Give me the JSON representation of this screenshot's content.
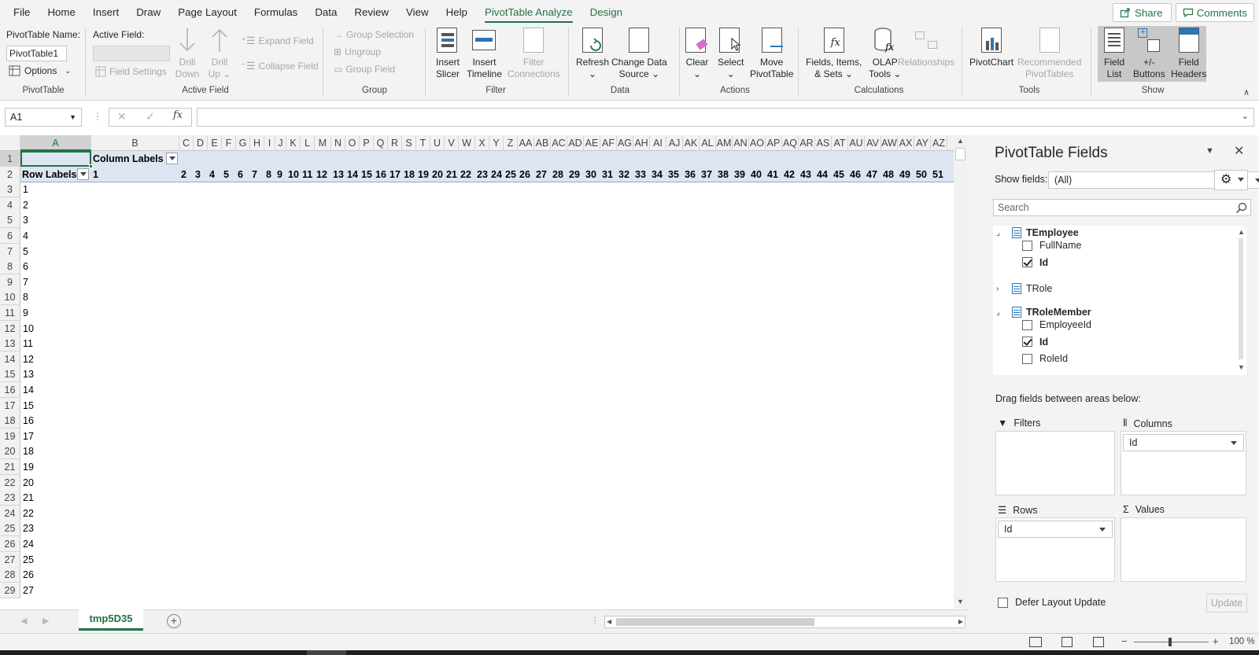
{
  "ribbon_tabs": [
    "File",
    "Home",
    "Insert",
    "Draw",
    "Page Layout",
    "Formulas",
    "Data",
    "Review",
    "View",
    "Help",
    "PivotTable Analyze",
    "Design"
  ],
  "active_tab": "PivotTable Analyze",
  "share_label": "Share",
  "comments_label": "Comments",
  "pivottable_group": {
    "name_label": "PivotTable Name:",
    "name_value": "PivotTable1",
    "options_label": "Options",
    "group_label": "PivotTable"
  },
  "active_field_group": {
    "label": "Active Field:",
    "field_settings": "Field Settings",
    "drill_down": [
      "Drill",
      "Down"
    ],
    "drill_up": [
      "Drill",
      "Up"
    ],
    "expand_field": "Expand Field",
    "collapse_field": "Collapse Field",
    "group_label": "Active Field"
  },
  "group_group": {
    "group_selection": "Group Selection",
    "ungroup": "Ungroup",
    "group_field": "Group Field",
    "group_label": "Group"
  },
  "filter_group": {
    "insert_slicer": [
      "Insert",
      "Slicer"
    ],
    "insert_timeline": [
      "Insert",
      "Timeline"
    ],
    "filter_connections": [
      "Filter",
      "Connections"
    ],
    "group_label": "Filter"
  },
  "data_group": {
    "refresh": "Refresh",
    "change_data_source": [
      "Change Data",
      "Source"
    ],
    "group_label": "Data"
  },
  "actions_group": {
    "clear": "Clear",
    "select": "Select",
    "move_pivottable": [
      "Move",
      "PivotTable"
    ],
    "group_label": "Actions"
  },
  "calculations_group": {
    "fields_items_sets": [
      "Fields, Items,",
      "& Sets"
    ],
    "olap_tools": [
      "OLAP",
      "Tools"
    ],
    "relationships": "Relationships",
    "group_label": "Calculations"
  },
  "tools_group": {
    "pivotchart": "PivotChart",
    "recommended_pivottables": [
      "Recommended",
      "PivotTables"
    ],
    "group_label": "Tools"
  },
  "show_group": {
    "field_list": [
      "Field",
      "List"
    ],
    "buttons": [
      "+/-",
      "Buttons"
    ],
    "field_headers": [
      "Field",
      "Headers"
    ],
    "group_label": "Show"
  },
  "name_box": "A1",
  "fx_label": "fx",
  "columns": [
    "A",
    "B",
    "C",
    "D",
    "E",
    "F",
    "G",
    "H",
    "I",
    "J",
    "K",
    "L",
    "M",
    "N",
    "O",
    "P",
    "Q",
    "R",
    "S",
    "T",
    "U",
    "V",
    "W",
    "X",
    "Y",
    "Z",
    "AA",
    "AB",
    "AC",
    "AD",
    "AE",
    "AF",
    "AG",
    "AH",
    "AI",
    "AJ",
    "AK",
    "AL",
    "AM",
    "AN",
    "AO",
    "AP",
    "AQ",
    "AR",
    "AS",
    "AT",
    "AU",
    "AV",
    "AW",
    "AX",
    "AY",
    "AZ"
  ],
  "rows": [
    "1",
    "2",
    "3",
    "4",
    "5",
    "6",
    "7",
    "8",
    "9",
    "10",
    "11",
    "12",
    "13",
    "14",
    "15",
    "16",
    "17",
    "18",
    "19",
    "20",
    "21",
    "22",
    "23",
    "24",
    "25",
    "26",
    "27",
    "28",
    "29"
  ],
  "pivot": {
    "column_labels": "Column Labels",
    "row_labels": "Row Labels",
    "column_values": [
      "1",
      "2",
      "3",
      "4",
      "5",
      "6",
      "7",
      "8",
      "9",
      "10",
      "11",
      "12",
      "13",
      "14",
      "15",
      "16",
      "17",
      "18",
      "19",
      "20",
      "21",
      "22",
      "23",
      "24",
      "25",
      "26",
      "27",
      "28",
      "29",
      "30",
      "31",
      "32",
      "33",
      "34",
      "35",
      "36",
      "37",
      "38",
      "39",
      "40",
      "41",
      "42",
      "43",
      "44",
      "45",
      "46",
      "47",
      "48",
      "49",
      "50",
      "51"
    ],
    "row_values": [
      "1",
      "2",
      "3",
      "4",
      "5",
      "6",
      "7",
      "8",
      "9",
      "10",
      "11",
      "12",
      "13",
      "14",
      "15",
      "16",
      "17",
      "18",
      "19",
      "20",
      "21",
      "22",
      "23",
      "24",
      "25",
      "26",
      "27"
    ]
  },
  "sheet_tab": "tmp5D35",
  "zoom": "100 %",
  "pane": {
    "title": "PivotTable Fields",
    "show_fields_label": "Show fields:",
    "show_fields_value": "(All)",
    "search_placeholder": "Search",
    "tables": [
      {
        "name": "TEmployee",
        "expanded": true,
        "fields": [
          {
            "name": "FullName",
            "checked": false
          },
          {
            "name": "Id",
            "checked": true
          }
        ]
      },
      {
        "name": "TRole",
        "expanded": false,
        "fields": []
      },
      {
        "name": "TRoleMember",
        "expanded": true,
        "fields": [
          {
            "name": "EmployeeId",
            "checked": false
          },
          {
            "name": "Id",
            "checked": true
          },
          {
            "name": "RoleId",
            "checked": false
          }
        ]
      }
    ],
    "drag_hint": "Drag fields between areas below:",
    "filters_label": "Filters",
    "columns_label": "Columns",
    "columns_value": "Id",
    "rows_label": "Rows",
    "rows_value": "Id",
    "values_label": "Values",
    "defer_label": "Defer Layout Update",
    "update_label": "Update"
  },
  "colors": {
    "accent": "#217346",
    "header_band": "#dde4f2"
  }
}
